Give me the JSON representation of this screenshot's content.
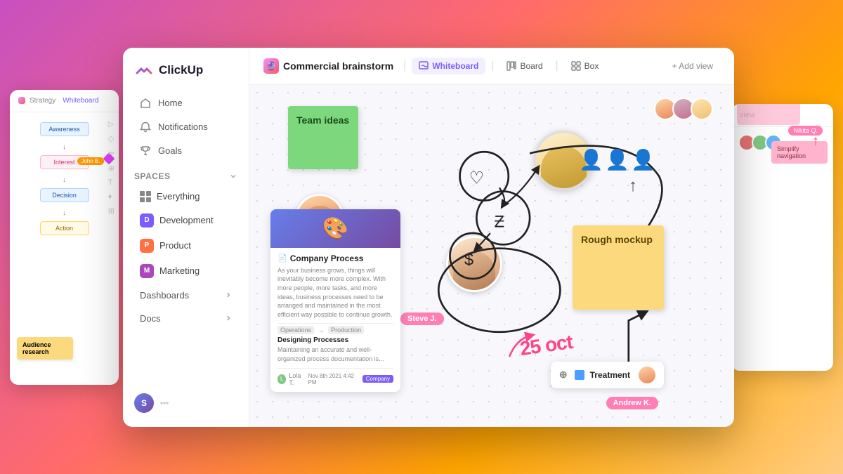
{
  "app": {
    "name": "ClickUp",
    "logo_text": "ClickUp"
  },
  "sidebar": {
    "nav": [
      {
        "label": "Home",
        "icon": "home-icon"
      },
      {
        "label": "Notifications",
        "icon": "bell-icon"
      },
      {
        "label": "Goals",
        "icon": "trophy-icon"
      }
    ],
    "spaces_label": "Spaces",
    "spaces": [
      {
        "label": "Everything",
        "icon": "grid-icon",
        "color": null
      },
      {
        "label": "Development",
        "icon": "space-dot",
        "color": "#7c5cfc",
        "letter": "D"
      },
      {
        "label": "Product",
        "icon": "space-dot",
        "color": "#ff7043",
        "letter": "P"
      },
      {
        "label": "Marketing",
        "icon": "space-dot",
        "color": "#ab47bc",
        "letter": "M"
      }
    ],
    "sections": [
      {
        "label": "Dashboards",
        "has_arrow": true
      },
      {
        "label": "Docs",
        "has_arrow": true
      }
    ],
    "user_initial": "S"
  },
  "header": {
    "project_icon": "🔮",
    "project_title": "Commercial brainstorm",
    "views": [
      {
        "label": "Whiteboard",
        "icon": "whiteboard-icon",
        "active": true
      },
      {
        "label": "Board",
        "icon": "board-icon",
        "active": false
      },
      {
        "label": "Box",
        "icon": "box-icon",
        "active": false
      }
    ],
    "add_view_label": "+ Add view"
  },
  "whiteboard": {
    "sticky_green_label": "Team ideas",
    "sticky_yellow_label": "Rough mockup",
    "doc_card": {
      "title": "Company Process",
      "text": "As your business grows, things will inevitably become more complex. With more people, more tasks, and more ideas, business processes need to be arranged and maintained in the most efficient way possible to continue growth.",
      "sections": "Operations → Production",
      "subtitle": "Designing Processes",
      "subtitle_text": "Maintaining an accurate and well-organized process documentation is...",
      "author": "Lola T.",
      "date": "Nov 8th 2021  4:42 PM",
      "tag": "Company"
    },
    "date_label": "25 oct",
    "label_steve": "Steve J.",
    "treatment_label": "Treatment",
    "label_nikita": "Nikita Q.",
    "label_andrew": "Andrew K."
  },
  "bg_left": {
    "tab1": "Strategy",
    "tab2": "Whiteboard",
    "boxes": [
      "Awareness",
      "Interest",
      "Decision",
      "Action"
    ],
    "note": "Audience research"
  },
  "bg_right": {
    "header": "view",
    "simplify_note": "Simplify navigation",
    "nikita": "Nikita Q."
  }
}
